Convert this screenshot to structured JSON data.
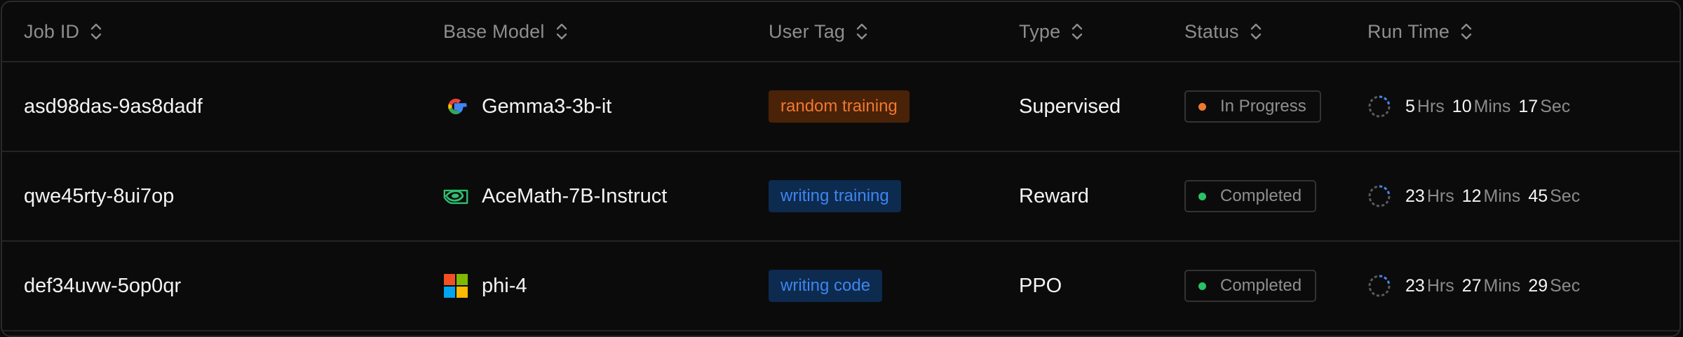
{
  "columns": [
    {
      "label": "Job ID"
    },
    {
      "label": "Base Model"
    },
    {
      "label": "User Tag"
    },
    {
      "label": "Type"
    },
    {
      "label": "Status"
    },
    {
      "label": "Run Time"
    }
  ],
  "rows": [
    {
      "job_id": "asd98das-9as8dadf",
      "model": {
        "name": "Gemma3-3b-it",
        "icon": "google-icon"
      },
      "tag": {
        "label": "random training",
        "color": "#f0782f",
        "bg": "#4a2208"
      },
      "type": "Supervised",
      "status": {
        "label": "In Progress",
        "dot_color": "#f0782f"
      },
      "run_time": {
        "hrs": "5",
        "hrs_unit": "Hrs",
        "mins": "10",
        "mins_unit": "Mins",
        "secs": "17",
        "secs_unit": "Sec"
      }
    },
    {
      "job_id": "qwe45rty-8ui7op",
      "model": {
        "name": "AceMath-7B-Instruct",
        "icon": "nvidia-icon"
      },
      "tag": {
        "label": "writing training",
        "color": "#3d86ee",
        "bg": "#0d2a4f"
      },
      "type": "Reward",
      "status": {
        "label": "Completed",
        "dot_color": "#29c266"
      },
      "run_time": {
        "hrs": "23",
        "hrs_unit": "Hrs",
        "mins": "12",
        "mins_unit": "Mins",
        "secs": "45",
        "secs_unit": "Sec"
      }
    },
    {
      "job_id": "def34uvw-5op0qr",
      "model": {
        "name": "phi-4",
        "icon": "microsoft-icon"
      },
      "tag": {
        "label": "writing code",
        "color": "#3d86ee",
        "bg": "#0d2a4f"
      },
      "type": "PPO",
      "status": {
        "label": "Completed",
        "dot_color": "#29c266"
      },
      "run_time": {
        "hrs": "23",
        "hrs_unit": "Hrs",
        "mins": "27",
        "mins_unit": "Mins",
        "secs": "29",
        "secs_unit": "Sec"
      }
    }
  ],
  "colors": {
    "background": "#0b0b0b",
    "border": "#2a2a2a",
    "header_text": "#8e8e8e",
    "body_text": "#f4f4f4",
    "muted_text": "#8b8b8b",
    "spinner_accent": "#3d86ee"
  }
}
